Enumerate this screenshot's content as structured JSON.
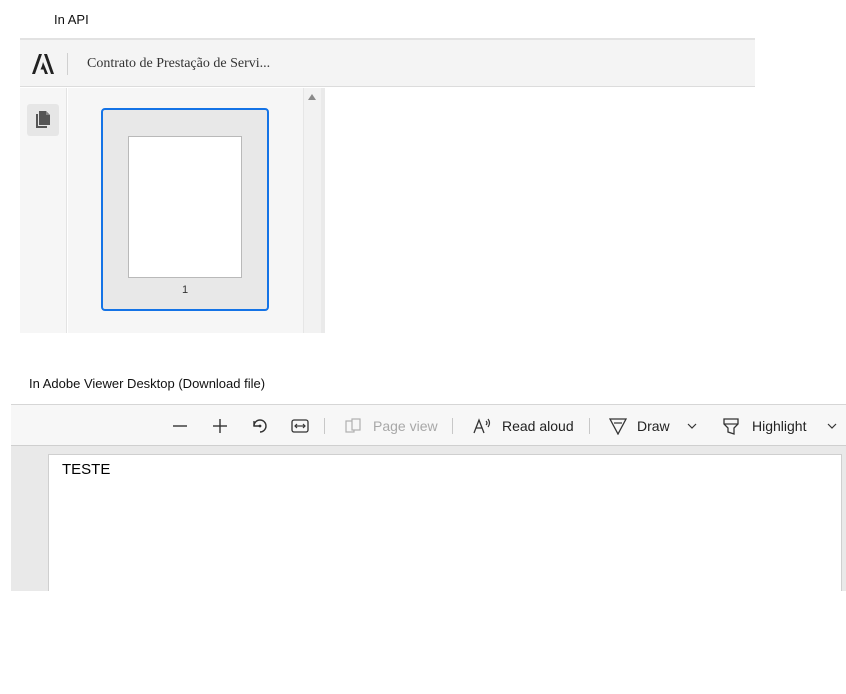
{
  "captions": {
    "api": "In API",
    "desktop": "In Adobe Viewer Desktop (Download file)"
  },
  "api_viewer": {
    "logo_icon": "adobe-logo-icon",
    "document_title": "Contrato de Prestação de Servi...",
    "rail_button_icon": "page-thumbnails-icon",
    "thumbnails": [
      {
        "page_number": "1",
        "selected": true
      }
    ],
    "accent_color": "#1473e6"
  },
  "desktop_viewer": {
    "toolbar": {
      "zoom_out_icon": "minus-icon",
      "zoom_in_icon": "plus-icon",
      "rotate_icon": "rotate-icon",
      "fit_width_icon": "fit-width-icon",
      "page_view_label": "Page view",
      "read_aloud_label": "Read aloud",
      "draw_label": "Draw",
      "highlight_label": "Highlight"
    },
    "document_text": "TESTE"
  }
}
